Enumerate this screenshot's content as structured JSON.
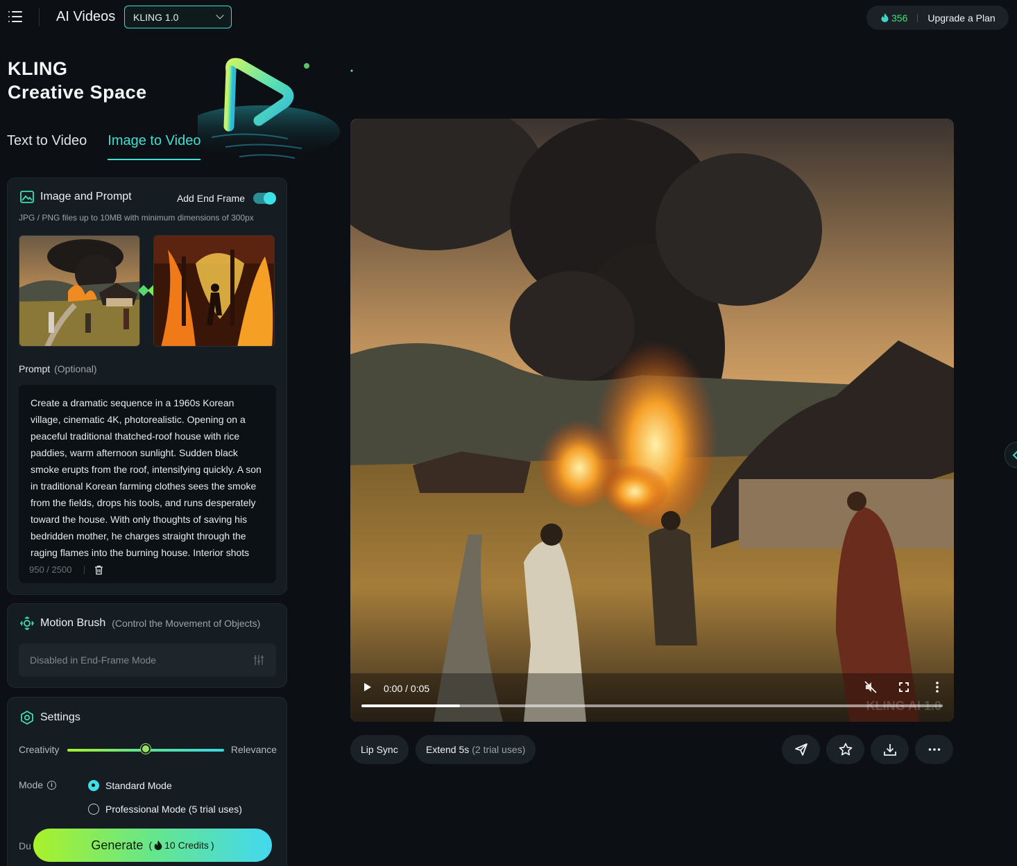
{
  "header": {
    "title": "AI Videos",
    "model": "KLING 1.0",
    "credits": "356",
    "upgrade_label": "Upgrade a Plan"
  },
  "hero": {
    "brand_line1": "KLING",
    "brand_line2": "Creative Space",
    "tabs": [
      {
        "label": "Text to Video",
        "active": false
      },
      {
        "label": "Image to Video",
        "active": true
      }
    ]
  },
  "image_panel": {
    "title": "Image and Prompt",
    "end_frame_label": "Add End Frame",
    "end_frame_enabled": true,
    "file_hint": "JPG / PNG files up to 10MB with minimum dimensions of 300px",
    "prompt_label": "Prompt",
    "prompt_optional": "(Optional)",
    "prompt_text": "Create a dramatic sequence in a 1960s Korean village, cinematic 4K, photorealistic. Opening on a peaceful traditional thatched-roof house with rice paddies, warm afternoon sunlight. Sudden black smoke erupts from the roof, intensifying quickly. A son in traditional Korean farming clothes sees the smoke from the fields, drops his tools, and runs desperately toward the house. With only thoughts of saving his bedridden mother, he charges straight through the raging flames into the burning house. Interior shots",
    "char_count": "950 / 2500"
  },
  "motion_panel": {
    "title": "Motion Brush",
    "subtitle": "(Control the Movement of Objects)",
    "disabled_text": "Disabled in End-Frame Mode"
  },
  "settings_panel": {
    "title": "Settings",
    "creativity_label": "Creativity",
    "relevance_label": "Relevance",
    "slider_value": 0.5,
    "mode_label": "Mode",
    "modes": [
      {
        "label": "Standard Mode",
        "selected": true
      },
      {
        "label": "Professional Mode (5 trial uses)",
        "selected": false
      }
    ],
    "duration_label": "Du"
  },
  "generate": {
    "label": "Generate",
    "open_paren": "(",
    "credits_text": "10 Credits",
    "close_paren": ")"
  },
  "video": {
    "time": "0:00 / 0:05",
    "progress": 0.17,
    "watermark": "KLING AI 1.0"
  },
  "actions": {
    "lip_sync": "Lip Sync",
    "extend": "Extend 5s",
    "extend_note": "(2 trial uses)"
  },
  "colors": {
    "accent": "#3ee0d6",
    "credits_green": "#44e07a",
    "background": "#0c1014",
    "panel": "#161d22"
  },
  "icons": [
    "menu-icon",
    "chevron-down-icon",
    "flame-icon",
    "image-icon",
    "link-icon",
    "trash-icon",
    "motion-icon",
    "sliders-icon",
    "settings-icon",
    "info-icon",
    "play-icon",
    "mute-icon",
    "fullscreen-icon",
    "more-vertical-icon",
    "send-icon",
    "star-icon",
    "download-icon",
    "more-horizontal-icon",
    "chevron-left-icon"
  ]
}
